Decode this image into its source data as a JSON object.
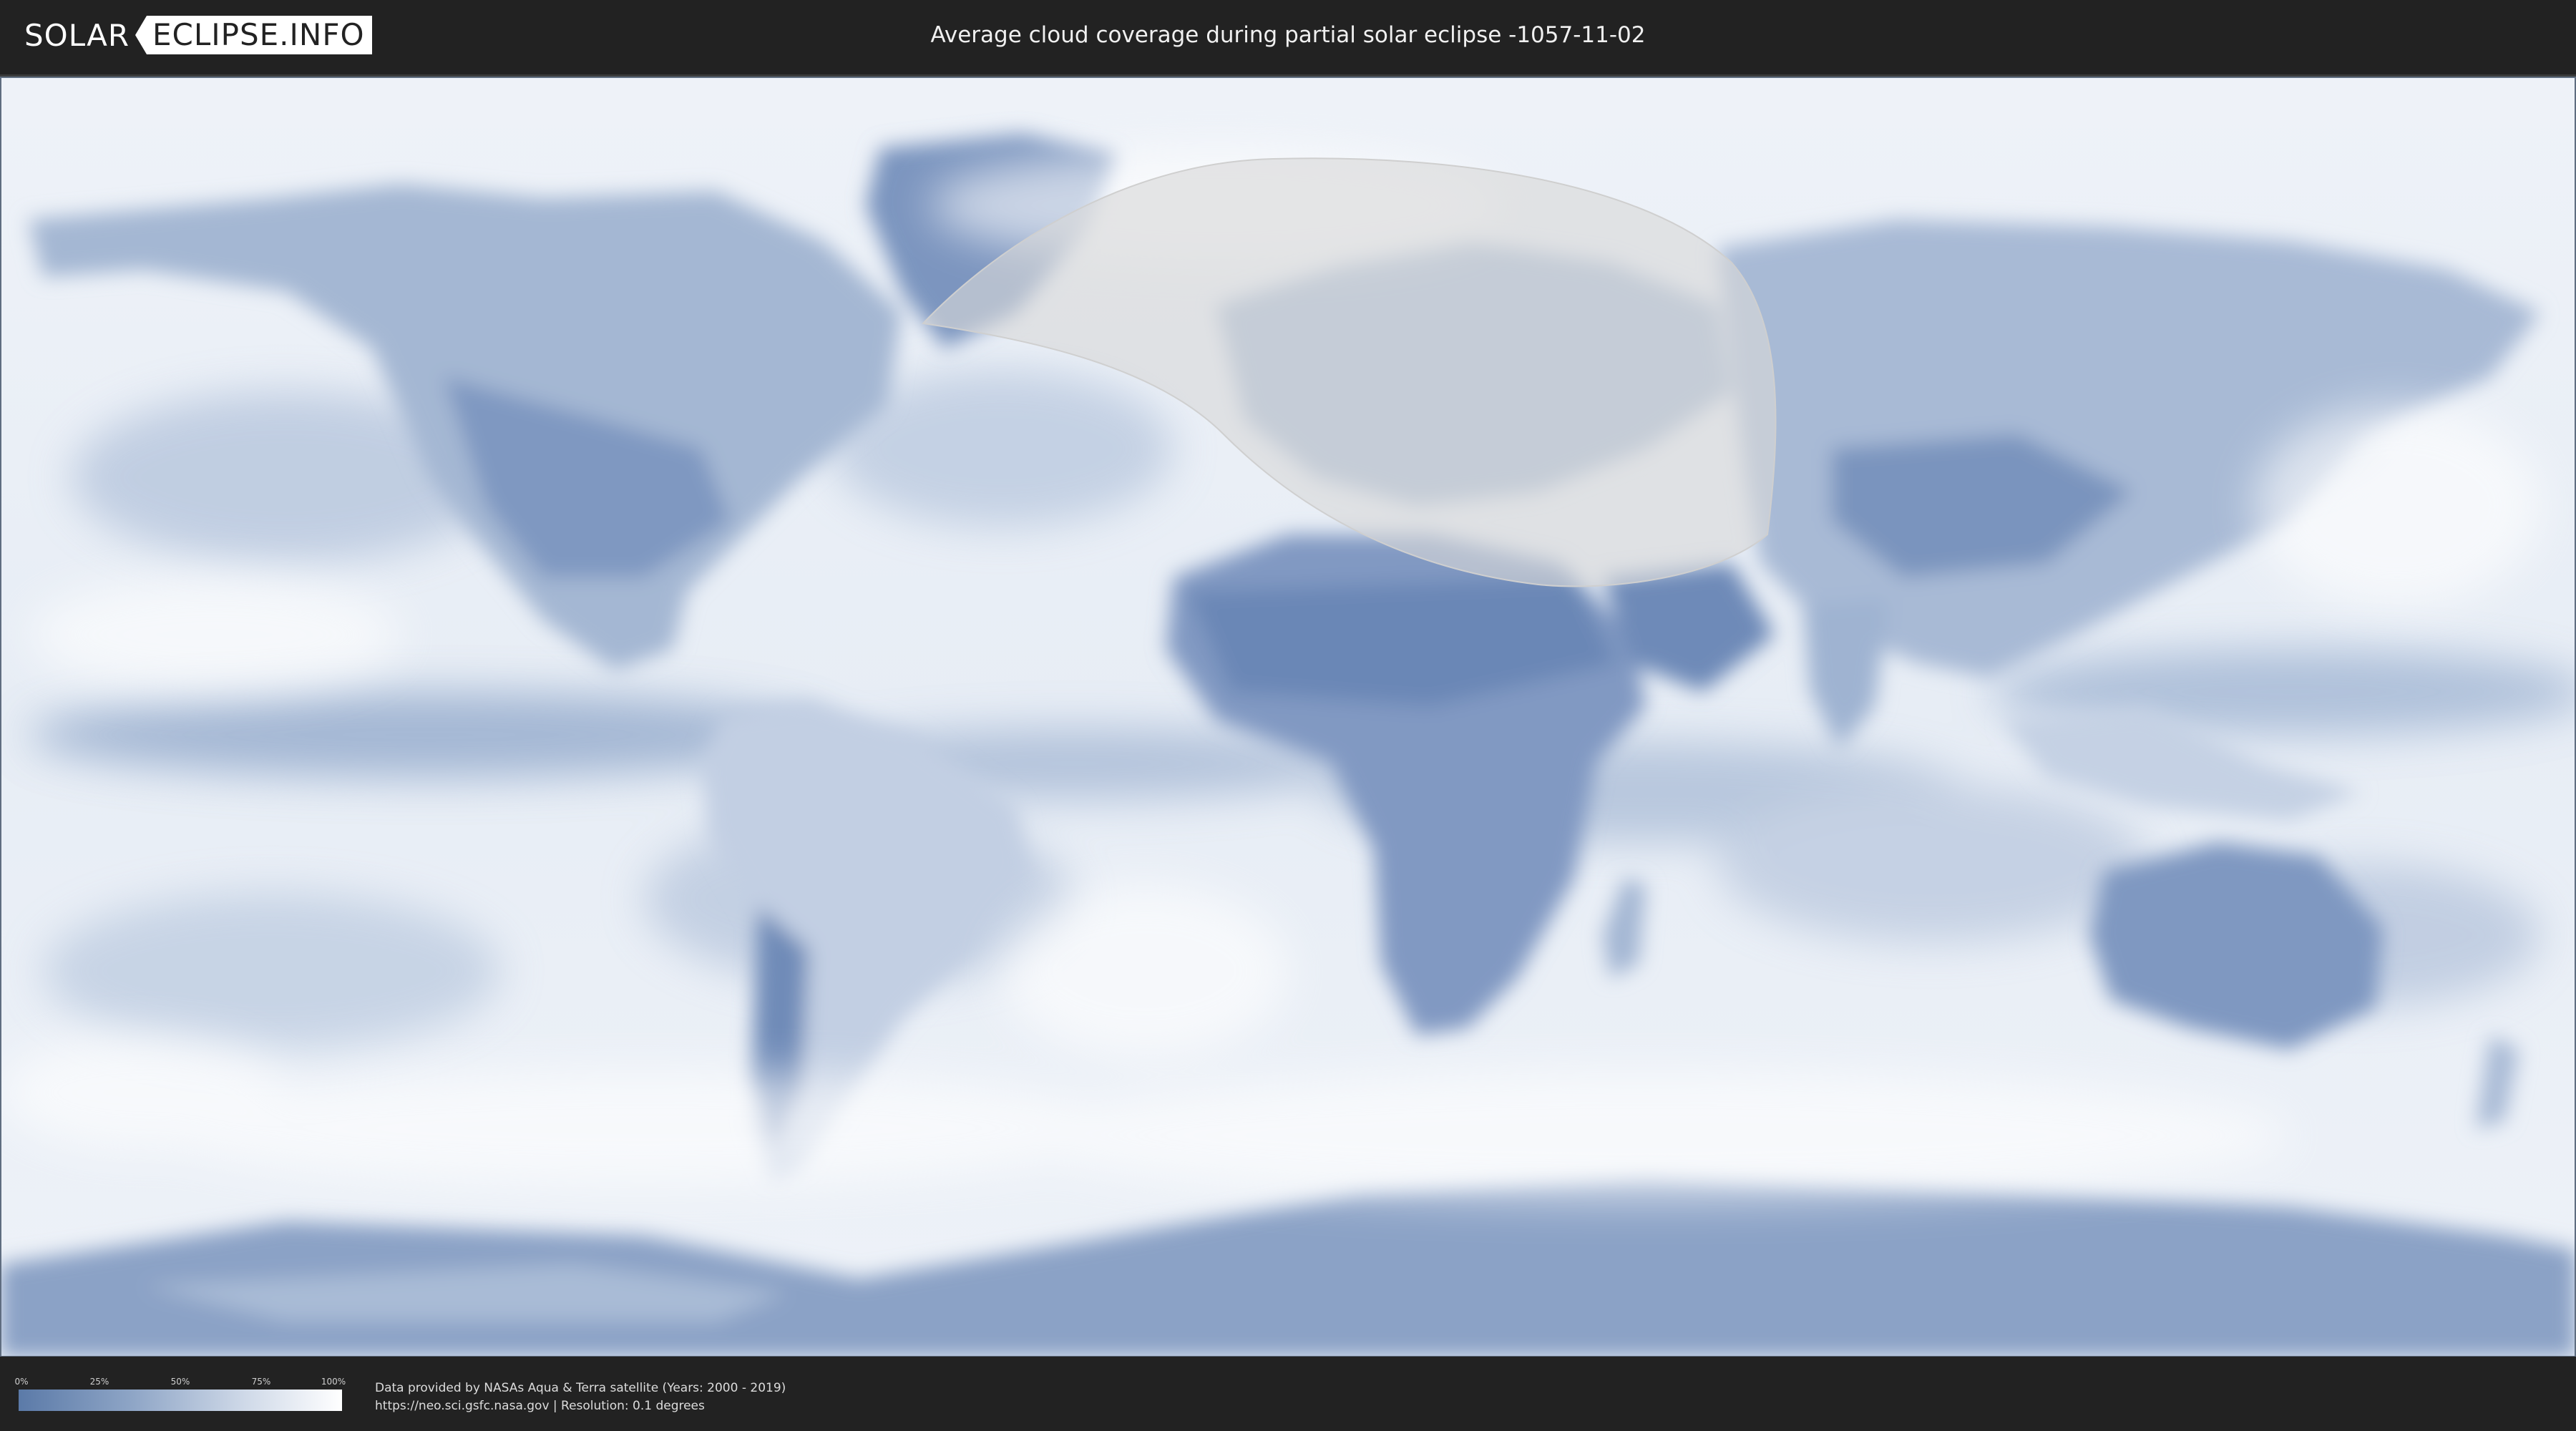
{
  "header": {
    "logo_left": "SOLAR",
    "logo_right": "ECLIPSE.INFO",
    "title": "Average cloud coverage during partial solar eclipse -1057-11-02"
  },
  "legend": {
    "ticks": [
      "0%",
      "25%",
      "50%",
      "75%",
      "100%"
    ],
    "tick_fractions": [
      0,
      0.25,
      0.5,
      0.75,
      1
    ],
    "colors": {
      "low": "#5b7aa8",
      "high": "#ffffff"
    }
  },
  "footer": {
    "line1": "Data provided by NASAs Aqua & Terra satellite (Years: 2000 - 2019)",
    "line2": "https://neo.sci.gsfc.nasa.gov | Resolution: 0.1 degrees"
  },
  "map": {
    "cloud_colors": {
      "clear": "#5b7aa8",
      "cloudy": "#f4f7fb"
    },
    "eclipse_zone_color": "#d9d9d9"
  }
}
